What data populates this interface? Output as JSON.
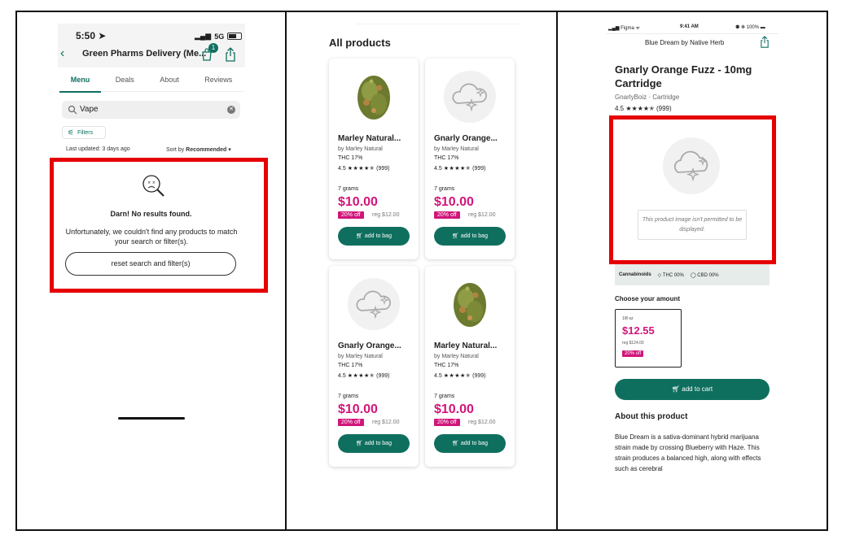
{
  "panel1": {
    "status": {
      "time": "5:50",
      "network": "5G"
    },
    "store_title": "Green Pharms Delivery (Me...",
    "bag_count": "1",
    "tabs": [
      "Menu",
      "Deals",
      "About",
      "Reviews"
    ],
    "active_tab": "Menu",
    "search": {
      "value": "Vape"
    },
    "filters_label": "Filters",
    "last_updated": "Last updated: 3 days ago",
    "sort_prefix": "Sort by",
    "sort_value": "Recommended",
    "no_results_title": "Darn! No results found.",
    "no_results_message": "Unfortunately, we couldn't find any products to match your search or filter(s).",
    "reset_label": "reset search and filter(s)"
  },
  "panel2": {
    "heading": "All products",
    "products": [
      {
        "name": "Marley Natural...",
        "brand": "by Marley Natural",
        "thc": "THC 17%",
        "rating": "4.5",
        "stars": "★★★★✭",
        "reviews": "(999)",
        "weight": "7 grams",
        "price": "$10.00",
        "discount": "20% off",
        "regular": "reg $12.00",
        "button": "add to bag",
        "image": "flower-photo"
      },
      {
        "name": "Gnarly Orange...",
        "brand": "by Marley Natural",
        "thc": "THC 17%",
        "rating": "4.5",
        "stars": "★★★★✭",
        "reviews": "(999)",
        "weight": "7 grams",
        "price": "$10.00",
        "discount": "20% off",
        "regular": "reg $12.00",
        "button": "add to bag",
        "image": "placeholder-cloud"
      },
      {
        "name": "Gnarly Orange...",
        "brand": "by Marley Natural",
        "thc": "THC 17%",
        "rating": "4.5",
        "stars": "★★★★✭",
        "reviews": "(999)",
        "weight": "7 grams",
        "price": "$10.00",
        "discount": "20% off",
        "regular": "reg $12.00",
        "button": "add to bag",
        "image": "placeholder-cloud"
      },
      {
        "name": "Marley Natural...",
        "brand": "by Marley Natural",
        "thc": "THC 17%",
        "rating": "4.5",
        "stars": "★★★★✭",
        "reviews": "(999)",
        "weight": "7 grams",
        "price": "$10.00",
        "discount": "20% off",
        "regular": "reg $12.00",
        "button": "add to bag",
        "image": "flower-photo"
      }
    ]
  },
  "panel3": {
    "status_left": "Figma",
    "status_time": "9:41 AM",
    "status_right": "100%",
    "store": "Blue Dream by Native Herb",
    "title": "Gnarly Orange Fuzz - 10mg Cartridge",
    "brand_line": "GnarlyBoiz · Cartridge",
    "rating": "4.5",
    "stars": "★★★★✭",
    "reviews": "(999)",
    "image_notice": "This product image isn't permitted to be displayed.",
    "cannabinoids_label": "Cannabinoids",
    "thc": "THC 00%",
    "cbd": "CBD 00%",
    "choose_label": "Choose your amount",
    "amount": {
      "size": "1/8 oz",
      "price": "$12.55",
      "regular": "reg $124.00",
      "discount": "20% off"
    },
    "add_to_cart": "add to cart",
    "about_title": "About this product",
    "about_text": "Blue Dream is a sativa-dominant hybrid marijuana strain made by crossing Blueberry with Haze. This strain produces a balanced high, along with effects such as cerebral"
  },
  "colors": {
    "brand_green": "#0f6f5f",
    "price_pink": "#d1157a",
    "highlight_red": "#e60000"
  }
}
